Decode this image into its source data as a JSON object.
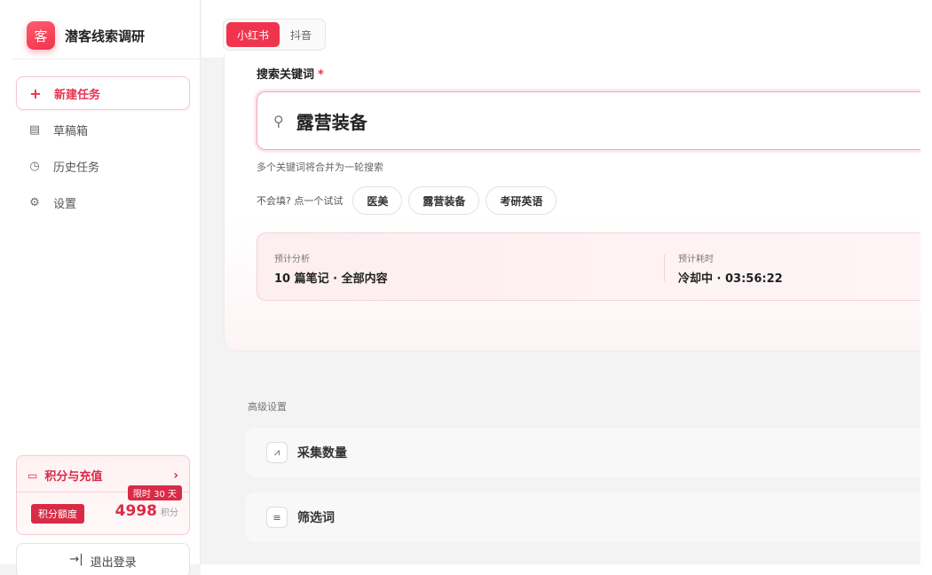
{
  "brand": {
    "logo_char": "客",
    "name": "潜客线索调研"
  },
  "platform_tabs": [
    {
      "label": "小红书",
      "active": true
    },
    {
      "label": "抖音",
      "active": false
    }
  ],
  "sidebar": {
    "items": [
      {
        "label": "新建任务",
        "icon": "plus-icon",
        "glyph": "+"
      },
      {
        "label": "草稿箱",
        "icon": "document-icon",
        "glyph": "▤"
      },
      {
        "label": "历史任务",
        "icon": "clock-icon",
        "glyph": "◷"
      },
      {
        "label": "设置",
        "icon": "gear-icon",
        "glyph": "⚙"
      }
    ]
  },
  "credits": {
    "title": "积分与充值",
    "chevron": "›",
    "limit_badge": "限时 30 天",
    "quota_label": "积分额度",
    "quota_value": "4998",
    "quota_unit": "积分",
    "card_glyph": "▭"
  },
  "logout": {
    "label": "退出登录",
    "glyph": "→|"
  },
  "search": {
    "label": "搜索关键词",
    "required_mark": "*",
    "value": "露营装备",
    "hint": "多个关键词将合并为一轮搜索",
    "try_label": "不会填? 点一个试试",
    "suggestions": [
      "医美",
      "露营装备",
      "考研英语"
    ],
    "search_glyph": "⚲"
  },
  "estimate": {
    "analysis_label": "预计分析",
    "analysis_value": "10 篇笔记 · 全部内容",
    "time_label": "预计耗时",
    "time_value": "冷却中 · 03:56:22"
  },
  "advanced": {
    "title": "高级设置",
    "rows": [
      {
        "label": "采集数量",
        "icon": "chart-icon",
        "glyph": "⩘"
      },
      {
        "label": "筛选词",
        "icon": "filter-icon",
        "glyph": "≡"
      }
    ]
  },
  "colors": {
    "accent": "#f0344d",
    "accent_dark": "#d92b46"
  }
}
